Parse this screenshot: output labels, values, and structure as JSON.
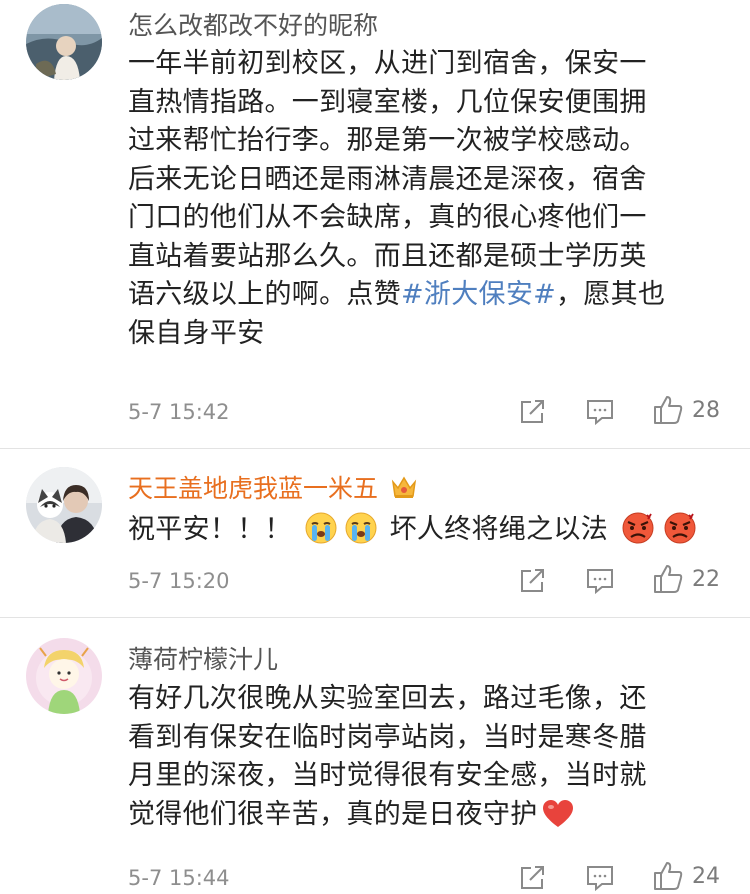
{
  "comments": [
    {
      "username": "怎么改都改不好的昵称",
      "lines": [
        "一年半前初到校区，从进门到宿舍，保安一",
        "直热情指路。一到寝室楼，几位保安便围拥",
        "过来帮忙抬行李。那是第一次被学校感动。",
        "后来无论日晒还是雨淋清晨还是深夜，宿舍",
        "门口的他们从不会缺席，真的很心疼他们一",
        "直站着要站那么久。而且还都是硕士学历英"
      ],
      "line7_pre": "语六级以上的啊。点赞",
      "line7_tag": "#浙大保安#",
      "line7_post": "，愿其也",
      "line8": "保自身平安",
      "time": "5-7 15:42",
      "likes": "28"
    },
    {
      "username": "天王盖地虎我蓝一米五",
      "text_pre": "祝平安！！！",
      "text_mid": "坏人终将绳之以法",
      "time": "5-7 15:20",
      "likes": "22"
    },
    {
      "username": "薄荷柠檬汁儿",
      "lines": [
        "有好几次很晚从实验室回去，路过毛像，还",
        "看到有保安在临时岗亭站岗，当时是寒冬腊",
        "月里的深夜，当时觉得很有安全感，当时就"
      ],
      "line4": "觉得他们很辛苦，真的是日夜守护",
      "time": "5-7 15:44",
      "likes": "24"
    }
  ],
  "icons": {
    "repost": "repost-icon",
    "comment": "comment-icon",
    "like": "thumbs-up-icon",
    "crown": "crown-icon",
    "cry": "crying-emoji",
    "angry": "angry-emoji",
    "heart": "heart-emoji"
  },
  "colors": {
    "vip_name": "#e86f1f",
    "hashtag": "#4f7fbf"
  }
}
